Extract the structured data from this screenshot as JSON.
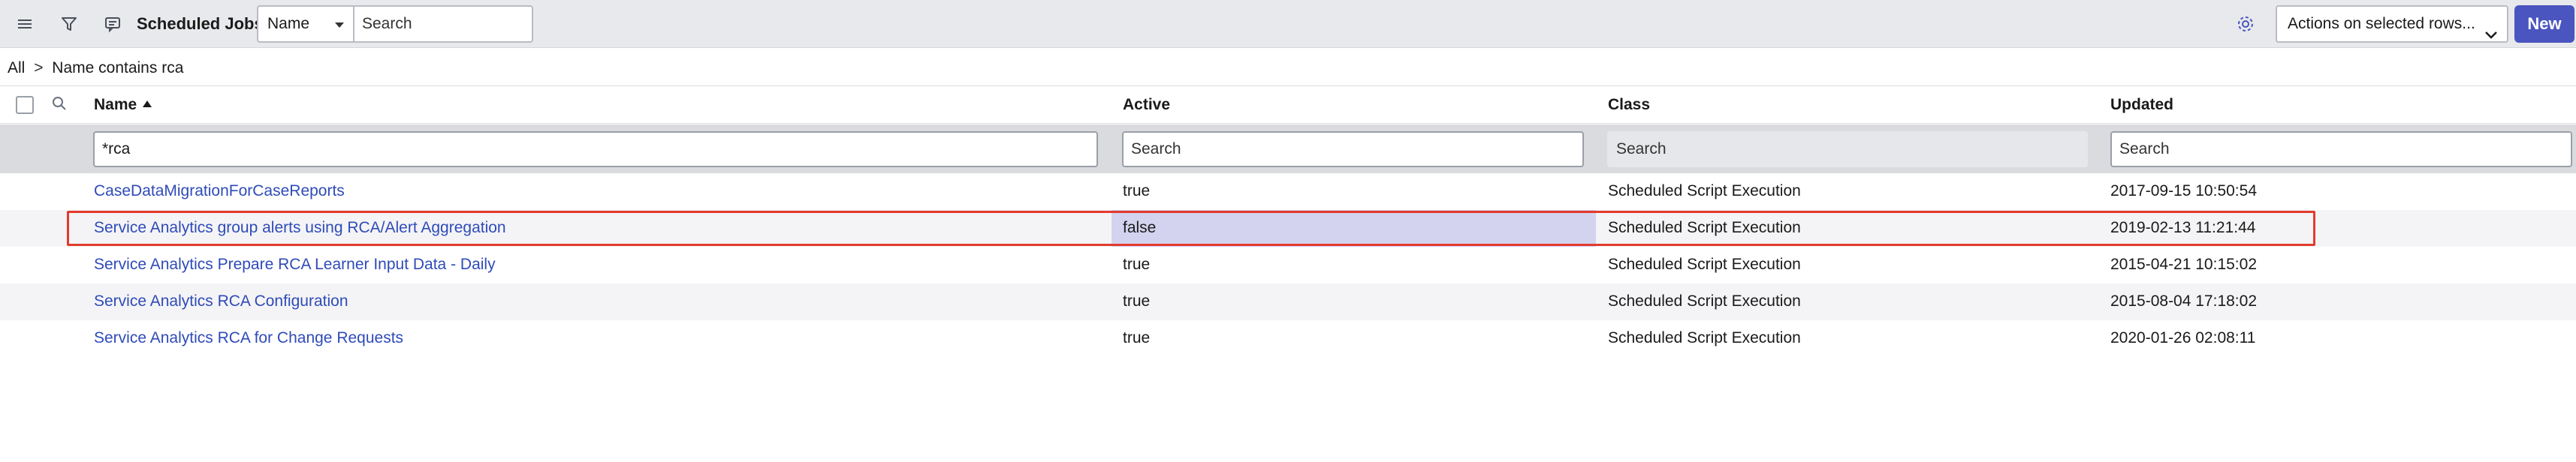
{
  "header": {
    "title": "Scheduled Jobs",
    "field_select": "Name",
    "search_placeholder": "Search",
    "actions_select": "Actions on selected rows...",
    "new_label": "New"
  },
  "breadcrumb": {
    "root": "All",
    "separator": ">",
    "condition": "Name contains rca"
  },
  "table": {
    "columns": [
      "Name",
      "Active",
      "Class",
      "Updated"
    ],
    "sort": {
      "column": "Name",
      "direction": "ascending"
    },
    "filters": {
      "name_value": "*rca",
      "active_placeholder": "Search",
      "class_placeholder": "Search",
      "updated_placeholder": "Search"
    },
    "rows": [
      {
        "name": "CaseDataMigrationForCaseReports",
        "active": "true",
        "class": "Scheduled Script Execution",
        "updated": "2017-09-15 10:50:54"
      },
      {
        "name": "Service Analytics group alerts using RCA/Alert Aggregation",
        "active": "false",
        "class": "Scheduled Script Execution",
        "updated": "2019-02-13 11:21:44"
      },
      {
        "name": "Service Analytics Prepare RCA Learner Input Data - Daily",
        "active": "true",
        "class": "Scheduled Script Execution",
        "updated": "2015-04-21 10:15:02"
      },
      {
        "name": "Service Analytics RCA Configuration",
        "active": "true",
        "class": "Scheduled Script Execution",
        "updated": "2015-08-04 17:18:02"
      },
      {
        "name": "Service Analytics RCA for Change Requests",
        "active": "true",
        "class": "Scheduled Script Execution",
        "updated": "2020-01-26 02:08:11"
      }
    ],
    "highlighted_row_index": 1,
    "selected_cell": {
      "row": 1,
      "column": "Active"
    }
  },
  "icons": [
    "hamburger-menu-icon",
    "filter-icon",
    "context-menu-icon",
    "gear-icon",
    "chevron-down-icon",
    "search-icon"
  ],
  "colors": {
    "accent": "#4a55c0",
    "link": "#2f4bb8",
    "highlight_border": "#e23b2e",
    "selected_cell": "#d3d3ef"
  }
}
